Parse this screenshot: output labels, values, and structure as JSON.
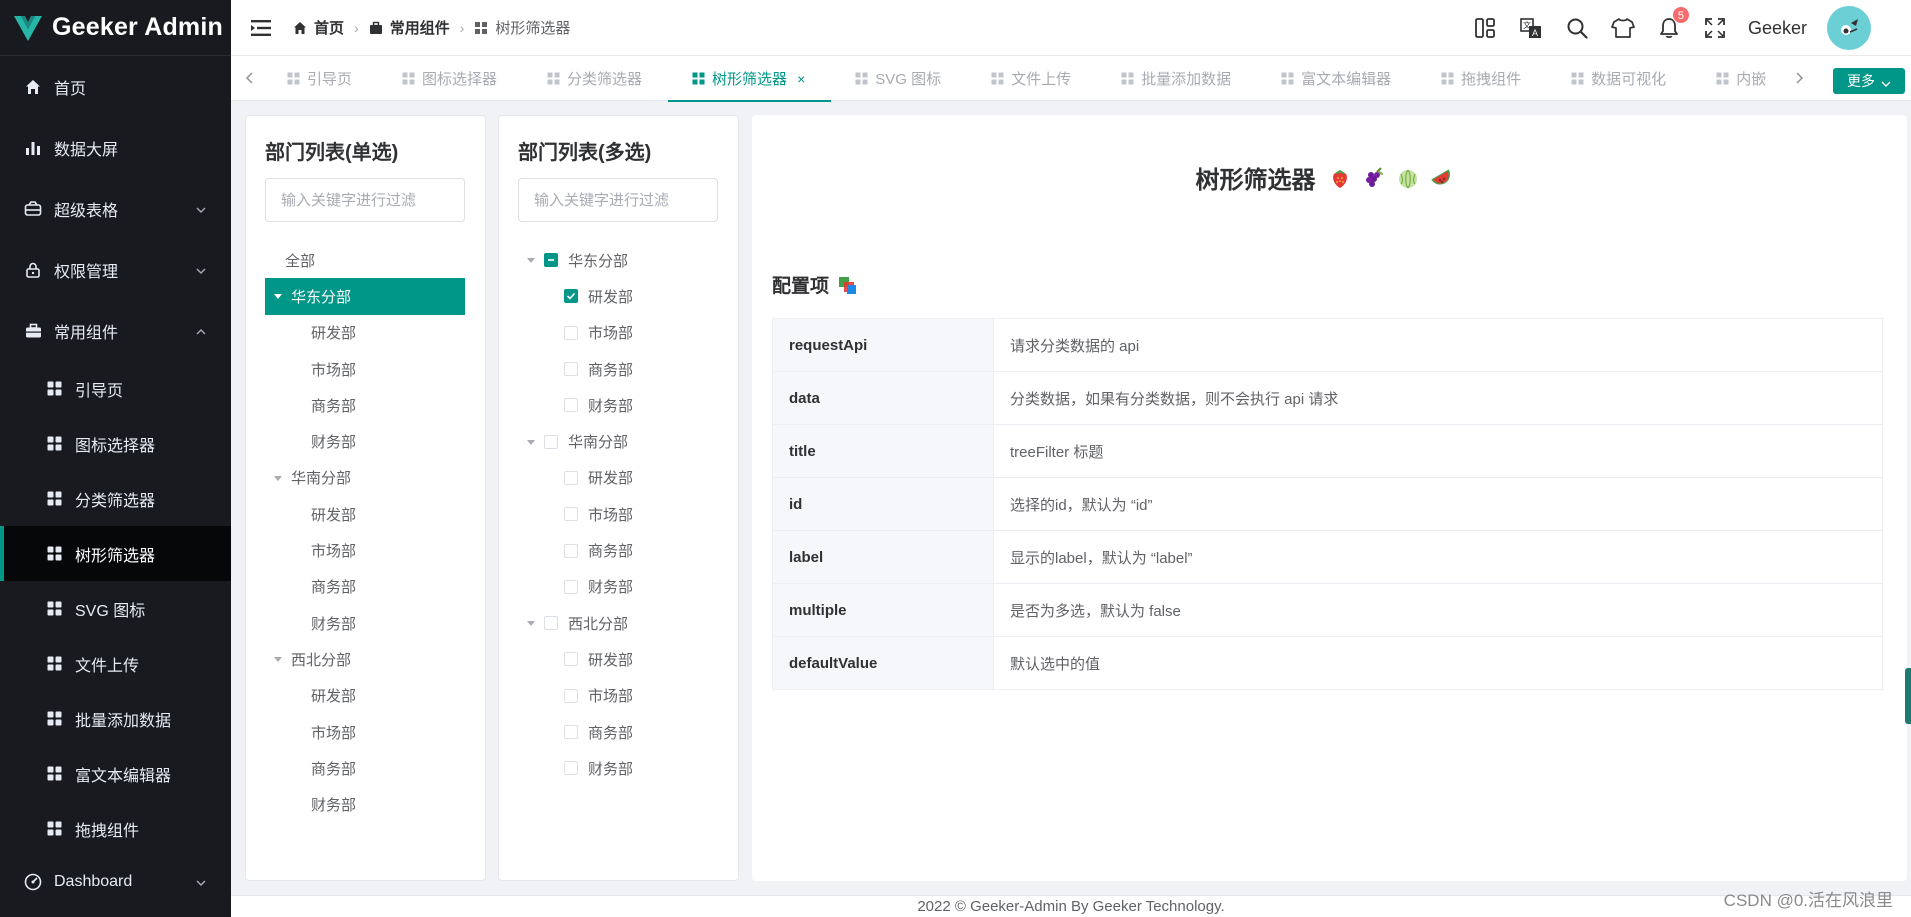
{
  "app": {
    "name": "Geeker Admin",
    "accent": "#009688"
  },
  "sidebar": {
    "items": [
      {
        "label": "首页",
        "icon": "home-icon"
      },
      {
        "label": "数据大屏",
        "icon": "bar-chart-icon"
      },
      {
        "label": "超级表格",
        "icon": "table-icon",
        "expandable": true
      },
      {
        "label": "权限管理",
        "icon": "lock-icon",
        "expandable": true
      },
      {
        "label": "常用组件",
        "icon": "briefcase-icon",
        "expandable": true,
        "expanded": true
      }
    ],
    "sub_items": [
      {
        "label": "引导页"
      },
      {
        "label": "图标选择器"
      },
      {
        "label": "分类筛选器"
      },
      {
        "label": "树形筛选器",
        "active": true
      },
      {
        "label": "SVG 图标"
      },
      {
        "label": "文件上传"
      },
      {
        "label": "批量添加数据"
      },
      {
        "label": "富文本编辑器"
      },
      {
        "label": "拖拽组件"
      }
    ],
    "bottom_item": {
      "label": "Dashboard",
      "icon": "dashboard-icon"
    }
  },
  "header": {
    "breadcrumb": [
      "首页",
      "常用组件",
      "树形筛选器"
    ],
    "notification_count": "5",
    "username": "Geeker"
  },
  "tabs": {
    "items": [
      {
        "label": "引导页"
      },
      {
        "label": "图标选择器"
      },
      {
        "label": "分类筛选器"
      },
      {
        "label": "树形筛选器",
        "active": true
      },
      {
        "label": "SVG 图标"
      },
      {
        "label": "文件上传"
      },
      {
        "label": "批量添加数据"
      },
      {
        "label": "富文本编辑器"
      },
      {
        "label": "拖拽组件"
      },
      {
        "label": "数据可视化"
      },
      {
        "label": "内嵌"
      }
    ],
    "more_label": "更多"
  },
  "single_tree": {
    "title": "部门列表(单选)",
    "placeholder": "输入关键字进行过滤",
    "all_label": "全部",
    "nodes": [
      {
        "label": "华东分部",
        "selected": true,
        "children": [
          "研发部",
          "市场部",
          "商务部",
          "财务部"
        ]
      },
      {
        "label": "华南分部",
        "children": [
          "研发部",
          "市场部",
          "商务部",
          "财务部"
        ]
      },
      {
        "label": "西北分部",
        "children": [
          "研发部",
          "市场部",
          "商务部",
          "财务部"
        ]
      }
    ]
  },
  "multi_tree": {
    "title": "部门列表(多选)",
    "placeholder": "输入关键字进行过滤",
    "nodes": [
      {
        "label": "华东分部",
        "state": "indeterminate",
        "children": [
          {
            "label": "研发部",
            "checked": true
          },
          {
            "label": "市场部",
            "checked": false
          },
          {
            "label": "商务部",
            "checked": false
          },
          {
            "label": "财务部",
            "checked": false
          }
        ]
      },
      {
        "label": "华南分部",
        "state": "unchecked",
        "children": [
          {
            "label": "研发部",
            "checked": false
          },
          {
            "label": "市场部",
            "checked": false
          },
          {
            "label": "商务部",
            "checked": false
          },
          {
            "label": "财务部",
            "checked": false
          }
        ]
      },
      {
        "label": "西北分部",
        "state": "unchecked",
        "children": [
          {
            "label": "研发部",
            "checked": false
          },
          {
            "label": "市场部",
            "checked": false
          },
          {
            "label": "商务部",
            "checked": false
          },
          {
            "label": "财务部",
            "checked": false
          }
        ]
      }
    ]
  },
  "main": {
    "title": "树形筛选器",
    "emojis": [
      "strawberry-icon",
      "grapes-icon",
      "melon-icon",
      "watermelon-icon"
    ],
    "section_title": "配置项",
    "config_rows": [
      {
        "key": "requestApi",
        "desc": "请求分类数据的 api"
      },
      {
        "key": "data",
        "desc": "分类数据，如果有分类数据，则不会执行 api 请求"
      },
      {
        "key": "title",
        "desc": "treeFilter 标题"
      },
      {
        "key": "id",
        "desc": "选择的id，默认为 “id”"
      },
      {
        "key": "label",
        "desc": "显示的label，默认为 “label”"
      },
      {
        "key": "multiple",
        "desc": "是否为多选，默认为 false"
      },
      {
        "key": "defaultValue",
        "desc": "默认选中的值"
      }
    ]
  },
  "footer": {
    "text": "2022 © Geeker-Admin By Geeker Technology."
  },
  "watermark": "CSDN @0.活在风浪里"
}
